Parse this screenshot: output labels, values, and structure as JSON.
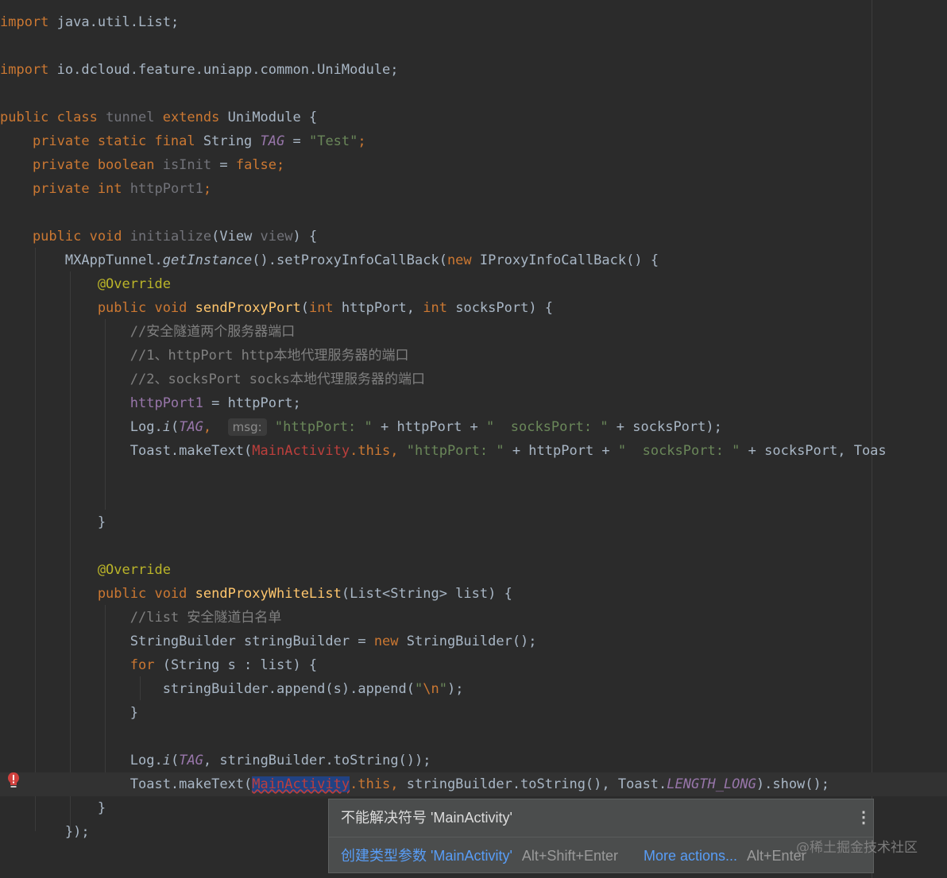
{
  "editor": {
    "lines": {
      "l0": {
        "a": "import",
        "b": " java.util.List;"
      },
      "l1": {
        "a": "import",
        "b": " io.dcloud.feature.uniapp.common.UniModule;"
      },
      "l2": {
        "a": "public class",
        "b": " tunnel",
        "c": " extends",
        "d": " UniModule {"
      },
      "l3": {
        "a": "    private static final",
        "b": " String ",
        "c": "TAG",
        "d": " = ",
        "e": "\"Test\"",
        "f": ";"
      },
      "l4": {
        "a": "    private boolean",
        "b": " isInit",
        "c": " = ",
        "d": "false;"
      },
      "l5": {
        "a": "    private int",
        "b": " httpPort1",
        "c": ";"
      },
      "l6": {
        "a": "    public void",
        "b": " initialize",
        "c": "(View ",
        "d": "view",
        "e": ") {"
      },
      "l7": {
        "a": "        MXAppTunnel.",
        "b": "getInstance",
        "c": "().setProxyInfoCallBack(",
        "d": "new",
        "e": " IProxyInfoCallBack() {"
      },
      "l8": {
        "a": "            @Override"
      },
      "l9": {
        "a": "            public void",
        "b": " sendProxyPort",
        "c": "(",
        "d": "int",
        "e": " httpPort, ",
        "f": "int",
        "g": " socksPort) {"
      },
      "l10": {
        "a": "                //安全隧道两个服务器端口"
      },
      "l11": {
        "a": "                //1、httpPort http本地代理服务器的端口"
      },
      "l12": {
        "a": "                //2、socksPort socks本地代理服务器的端口"
      },
      "l13": {
        "a": "                httpPort1",
        "b": " = httpPort;"
      },
      "l14": {
        "a": "                Log.",
        "b": "i",
        "c": "(",
        "d": "TAG",
        "e": ",  ",
        "hint": "msg:",
        "f": " ",
        "g": "\"httpPort: \"",
        "h": " + httpPort + ",
        "i": "\"  socksPort: \"",
        "j": " + socksPort);"
      },
      "l15": {
        "a": "                Toast.makeText(",
        "b": "MainActivity",
        "c": ".this, ",
        "d": "\"httpPort: \"",
        "e": " + httpPort + ",
        "f": "\"  socksPort: \"",
        "g": " + socksPort, Toas"
      },
      "l16": {
        "a": "            }"
      },
      "l17": {
        "a": "            @Override"
      },
      "l18": {
        "a": "            public void",
        "b": " sendProxyWhiteList",
        "c": "(List<String> list) {"
      },
      "l19": {
        "a": "                //list 安全隧道白名单"
      },
      "l20": {
        "a": "                StringBuilder stringBuilder = ",
        "b": "new",
        "c": " StringBuilder();"
      },
      "l21": {
        "a": "                for",
        "b": " (String s : list) {"
      },
      "l22": {
        "a": "                    stringBuilder.append(s).append(",
        "b": "\"",
        "c": "\\n",
        "d": "\"",
        "e": ");"
      },
      "l23": {
        "a": "                }"
      },
      "l24": {
        "a": "                Log.",
        "b": "i",
        "c": "(",
        "d": "TAG",
        "e": ", stringBuilder.toString());"
      },
      "l25": {
        "a": "                Toast.makeText(",
        "b": "MainActivity",
        "c": ".this, ",
        "d": "stringBuilder.toString(), Toast.",
        "e": "LENGTH_LONG",
        "f": ").show();"
      },
      "l26": {
        "a": "            }"
      },
      "l27": {
        "a": "        });"
      }
    }
  },
  "popup": {
    "message": "不能解决符号 'MainActivity'",
    "quickfix": "创建类型参数 'MainActivity'",
    "quickfix_shortcut": "Alt+Shift+Enter",
    "more_actions": "More actions...",
    "more_shortcut": "Alt+Enter"
  },
  "watermark": "@稀土掘金技术社区",
  "icons": {
    "error": "error-bulb-icon",
    "more": "more-vertical-icon"
  },
  "colors": {
    "background": "#2b2b2b",
    "keyword": "#cc7832",
    "string": "#6a8759",
    "comment": "#808080",
    "annotation": "#bbb529",
    "method": "#ffc66d",
    "field": "#9876aa",
    "error": "#bc3f3c",
    "link": "#589df6"
  }
}
